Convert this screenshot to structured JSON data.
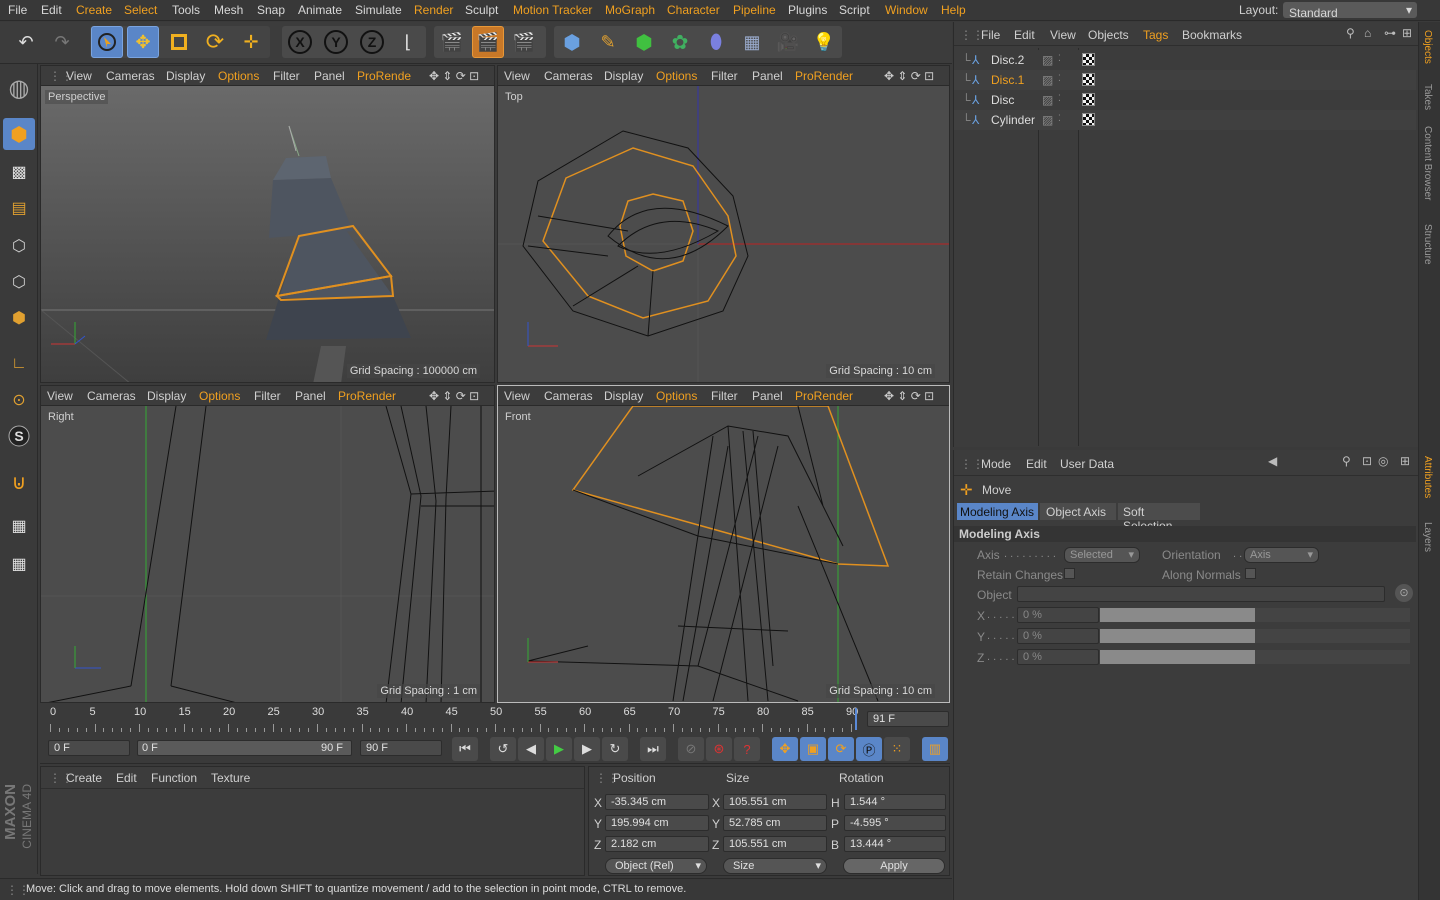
{
  "menu": {
    "items": [
      "File",
      "Edit",
      "Create",
      "Select",
      "Tools",
      "Mesh",
      "Snap",
      "Animate",
      "Simulate",
      "Render",
      "Sculpt",
      "Motion Tracker",
      "MoGraph",
      "Character",
      "Pipeline",
      "Plugins",
      "Script",
      "Window",
      "Help"
    ],
    "layout_label": "Layout:",
    "layout_value": "Standard"
  },
  "viewport_menu": {
    "view": "View",
    "cameras": "Cameras",
    "display": "Display",
    "options": "Options",
    "filter": "Filter",
    "panel": "Panel",
    "prorender": "ProRender",
    "prorender_short": "ProRende"
  },
  "viewports": {
    "perspective": {
      "name": "Perspective",
      "grid": "Grid Spacing : 100000 cm"
    },
    "top": {
      "name": "Top",
      "grid": "Grid Spacing : 10 cm"
    },
    "right": {
      "name": "Right",
      "grid": "Grid Spacing : 1 cm"
    },
    "front": {
      "name": "Front",
      "grid": "Grid Spacing : 10 cm"
    }
  },
  "timeline": {
    "ticks": [
      "0",
      "5",
      "10",
      "15",
      "20",
      "25",
      "30",
      "35",
      "40",
      "45",
      "50",
      "55",
      "60",
      "65",
      "70",
      "75",
      "80",
      "85",
      "90"
    ],
    "current": "91 F"
  },
  "transport": {
    "start": "0 F",
    "range_start": "0 F",
    "range_end": "90 F",
    "end": "90 F"
  },
  "material_menu": {
    "create": "Create",
    "edit": "Edit",
    "function": "Function",
    "texture": "Texture"
  },
  "coords": {
    "position_hdr": "Position",
    "size_hdr": "Size",
    "rotation_hdr": "Rotation",
    "px": "-35.345 cm",
    "py": "195.994 cm",
    "pz": "2.182 cm",
    "sx": "105.551 cm",
    "sy": "52.785 cm",
    "sz": "105.551 cm",
    "rh": "1.544 °",
    "rp": "-4.595 °",
    "rb": "13.444 °",
    "lx": "X",
    "ly": "Y",
    "lz": "Z",
    "lh": "H",
    "lp": "P",
    "lb": "B",
    "mode": "Object (Rel)",
    "size_mode": "Size",
    "apply": "Apply"
  },
  "status": "Move: Click and drag to move elements. Hold down SHIFT to quantize movement / add to the selection in point mode, CTRL to remove.",
  "objects_menu": {
    "file": "File",
    "edit": "Edit",
    "view": "View",
    "objects": "Objects",
    "tags": "Tags",
    "bookmarks": "Bookmarks"
  },
  "objects": [
    {
      "name": "Disc.2",
      "selected": false
    },
    {
      "name": "Disc.1",
      "selected": true
    },
    {
      "name": "Disc",
      "selected": false
    },
    {
      "name": "Cylinder",
      "selected": false
    }
  ],
  "attr_menu": {
    "mode": "Mode",
    "edit": "Edit",
    "user_data": "User Data"
  },
  "attr": {
    "tool": "Move",
    "tabs": [
      "Modeling Axis",
      "Object Axis",
      "Soft Selection"
    ],
    "section": "Modeling Axis",
    "axis_lbl": "Axis",
    "axis_val": "Selected",
    "orientation_lbl": "Orientation",
    "orientation_val": "Axis",
    "retain_lbl": "Retain Changes",
    "normals_lbl": "Along Normals",
    "object_lbl": "Object",
    "x_lbl": "X",
    "y_lbl": "Y",
    "z_lbl": "Z",
    "x_val": "0 %",
    "y_val": "0 %",
    "z_val": "0 %",
    "x_pct": 0,
    "y_pct": 0,
    "z_pct": 0
  },
  "side_tabs": [
    "Objects",
    "Takes",
    "Content Browser",
    "Structure"
  ],
  "side_tabs2": [
    "Attributes",
    "Layers"
  ],
  "brand": {
    "maxon": "MAXON",
    "cinema": "CINEMA 4D"
  },
  "colors": {
    "accent": "#f0a020",
    "selection": "#5a86c8",
    "wire_select": "#e09020"
  }
}
